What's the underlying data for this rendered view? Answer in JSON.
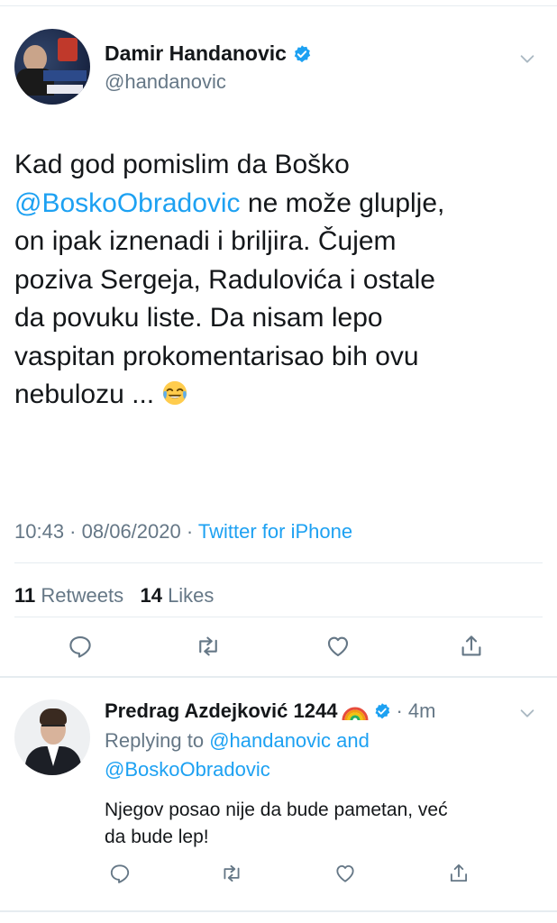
{
  "main_tweet": {
    "author_name": "Damir Handanovic",
    "author_handle": "@handanovic",
    "text_lines": [
      {
        "before": "Kad god pomislim da Boško",
        "mention": "",
        "after": ""
      },
      {
        "before": "",
        "mention": "@BoskoObradovic",
        "after": " ne može gluplje,"
      },
      {
        "before": "on ipak iznenadi i briljira. Čujem",
        "mention": "",
        "after": ""
      },
      {
        "before": "poziva Sergeja, Radulovića i ostale",
        "mention": "",
        "after": ""
      },
      {
        "before": "da povuku liste. Da nisam lepo",
        "mention": "",
        "after": ""
      },
      {
        "before": "vaspitan prokomentarisao bih ovu",
        "mention": "",
        "after": ""
      },
      {
        "before": "nebulozu ... ",
        "mention": "",
        "after": ""
      }
    ],
    "emoji": "face-with-tears-of-joy",
    "time": "10:43",
    "date": "08/06/2020",
    "meta_sep": " · ",
    "source": "Twitter for iPhone",
    "retweets_count": "11",
    "retweets_label": "Retweets",
    "likes_count": "14",
    "likes_label": "Likes"
  },
  "reply_tweet": {
    "author_name": "Predrag Azdejković 1244",
    "time_ago": "· 4m",
    "replying_prefix": "Replying to ",
    "replying_mention_1": "@handanovic",
    "replying_and": " and",
    "replying_mention_2": "@BoskoObradovic",
    "text_line_1": "Njegov posao nije da bude pametan, već",
    "text_line_2": "da bude lep!"
  },
  "icons": {
    "verified": "verified-badge-icon",
    "chevron": "chevron-down-icon",
    "reply": "reply-icon",
    "retweet": "retweet-icon",
    "like": "heart-icon",
    "share": "share-icon",
    "rainbow": "rainbow-emoji-icon"
  },
  "colors": {
    "accent": "#1da1f2",
    "text": "#14171a",
    "muted": "#657786",
    "divider": "#e6ecf0"
  }
}
